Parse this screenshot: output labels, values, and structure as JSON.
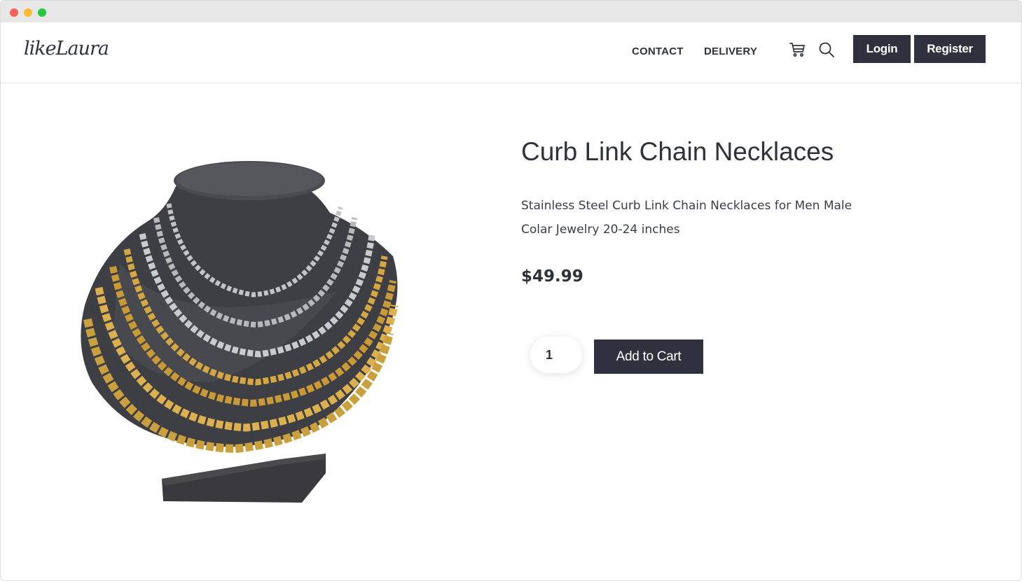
{
  "brand": {
    "logo_text": "likeLaura"
  },
  "nav": {
    "links": [
      "CONTACT",
      "DELIVERY"
    ],
    "login_label": "Login",
    "register_label": "Register"
  },
  "product": {
    "title": "Curb Link Chain Necklaces",
    "description": "Stainless Steel Curb Link Chain Necklaces for Men Male Colar Jewelry 20-24 inches",
    "price": "$49.99",
    "quantity": "1",
    "add_to_cart_label": "Add to Cart"
  },
  "colors": {
    "dark": "#2f323e",
    "gold": "#d4a742",
    "silver": "#c3c4c6"
  }
}
